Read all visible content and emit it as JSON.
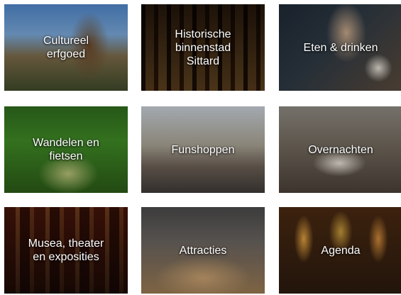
{
  "tiles": [
    {
      "label": "Cultureel\nerfgoed"
    },
    {
      "label": "Historische\nbinnenstad\nSittard"
    },
    {
      "label": "Eten & drinken"
    },
    {
      "label": "Wandelen en\nfietsen"
    },
    {
      "label": "Funshoppen"
    },
    {
      "label": "Overnachten"
    },
    {
      "label": "Musea, theater\nen exposities"
    },
    {
      "label": "Attracties"
    },
    {
      "label": "Agenda"
    }
  ]
}
